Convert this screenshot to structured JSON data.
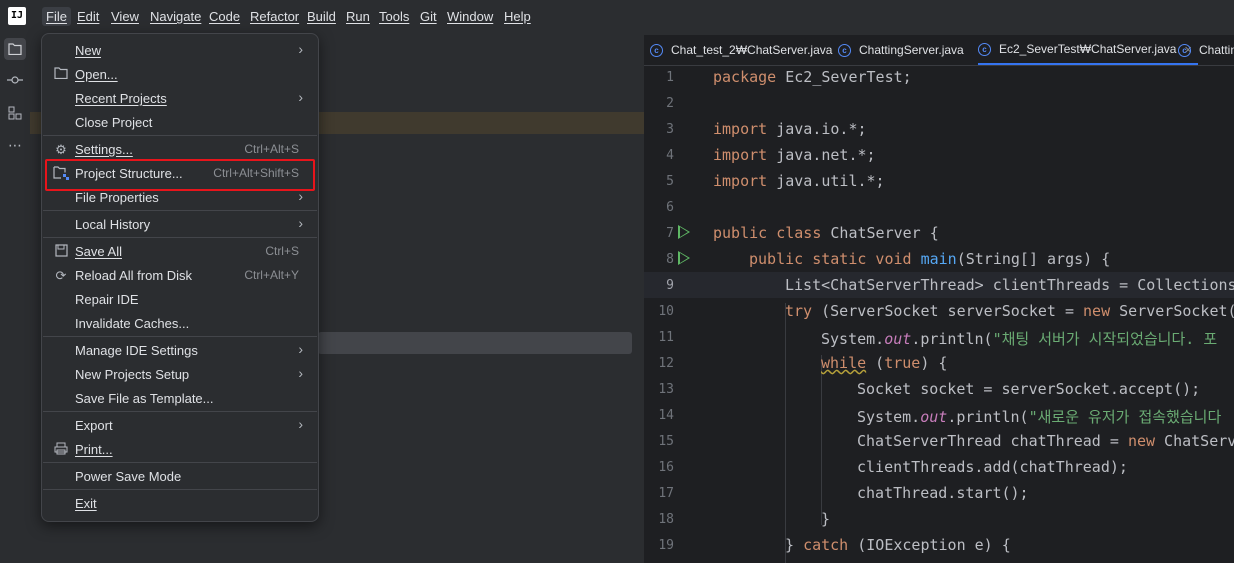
{
  "menubar": {
    "logo": "IJ",
    "items": [
      "File",
      "Edit",
      "View",
      "Navigate",
      "Code",
      "Refactor",
      "Build",
      "Run",
      "Tools",
      "Git",
      "Window",
      "Help"
    ]
  },
  "sidebar": {
    "icons": [
      "folder-icon",
      "commit-icon",
      "structure-icon",
      "more-icon"
    ]
  },
  "file_menu": {
    "items": [
      {
        "label": "New",
        "shortcut": "",
        "submenu": true
      },
      {
        "label": "Open...",
        "shortcut": "",
        "submenu": false
      },
      {
        "label": "Recent Projects",
        "shortcut": "",
        "submenu": true
      },
      {
        "label": "Close Project",
        "shortcut": "",
        "submenu": false
      },
      {
        "label": "Settings...",
        "shortcut": "Ctrl+Alt+S",
        "submenu": false
      },
      {
        "label": "Project Structure...",
        "shortcut": "Ctrl+Alt+Shift+S",
        "submenu": false
      },
      {
        "label": "File Properties",
        "shortcut": "",
        "submenu": true
      },
      {
        "label": "Local History",
        "shortcut": "",
        "submenu": true
      },
      {
        "label": "Save All",
        "shortcut": "Ctrl+S",
        "submenu": false
      },
      {
        "label": "Reload All from Disk",
        "shortcut": "Ctrl+Alt+Y",
        "submenu": false
      },
      {
        "label": "Repair IDE",
        "shortcut": "",
        "submenu": false
      },
      {
        "label": "Invalidate Caches...",
        "shortcut": "",
        "submenu": false
      },
      {
        "label": "Manage IDE Settings",
        "shortcut": "",
        "submenu": true
      },
      {
        "label": "New Projects Setup",
        "shortcut": "",
        "submenu": true
      },
      {
        "label": "Save File as Template...",
        "shortcut": "",
        "submenu": false
      },
      {
        "label": "Export",
        "shortcut": "",
        "submenu": true
      },
      {
        "label": "Print...",
        "shortcut": "",
        "submenu": false
      },
      {
        "label": "Power Save Mode",
        "shortcut": "",
        "submenu": false
      },
      {
        "label": "Exit",
        "shortcut": "",
        "submenu": false
      }
    ]
  },
  "editor": {
    "tabs": [
      {
        "label": "Chat_test_2₩ChatServer.java",
        "active": false
      },
      {
        "label": "ChattingServer.java",
        "active": false
      },
      {
        "label": "Ec2_SeverTest₩ChatServer.java",
        "active": true
      },
      {
        "label": "Chattin",
        "active": false
      }
    ],
    "current_line": 9,
    "line_numbers": [
      "1",
      "2",
      "3",
      "4",
      "5",
      "6",
      "7",
      "8",
      "9",
      "10",
      "11",
      "12",
      "13",
      "14",
      "15",
      "16",
      "17",
      "18",
      "19"
    ],
    "code": {
      "l1_kw": "package",
      "l1_rest": " Ec2_SeverTest;",
      "l3_kw": "import",
      "l3_rest": " java.io.*;",
      "l4_kw": "import",
      "l4_rest": " java.net.*;",
      "l5_kw": "import",
      "l5_rest": " java.util.*;",
      "l7_kw": "public class",
      "l7_rest": " ChatServer {",
      "l8_kw": "public static void",
      "l8_fn": "main",
      "l8_rest": "(String[] args) {",
      "l9": "List<ChatServerThread> clientThreads = Collections",
      "l10_kw": "try",
      "l10_a": " (ServerSocket serverSocket = ",
      "l10_kw2": "new",
      "l10_b": " ServerSocket(",
      "l11_a": "System.",
      "l11_it": "out",
      "l11_b": ".println(",
      "l11_st": "\"채팅 서버가 시작되었습니다. 포",
      "l12_kw": "while",
      "l12_a": " (",
      "l12_kw2": "true",
      "l12_b": ") {",
      "l13": "Socket socket = serverSocket.accept();",
      "l14_a": "System.",
      "l14_it": "out",
      "l14_b": ".println(",
      "l14_st": "\"새로운 유저가 접속했습니다",
      "l15_a": "ChatServerThread chatThread = ",
      "l15_kw": "new",
      "l15_b": " ChatServ",
      "l16": "clientThreads.add(chatThread);",
      "l17": "chatThread.start();",
      "l18": "}",
      "l19_a": "} ",
      "l19_kw": "catch",
      "l19_b": " (IOException e) {"
    }
  },
  "colors": {
    "highlight_box": "#e8141b",
    "accent": "#3574f0",
    "run_gutter": "#5fb865"
  }
}
